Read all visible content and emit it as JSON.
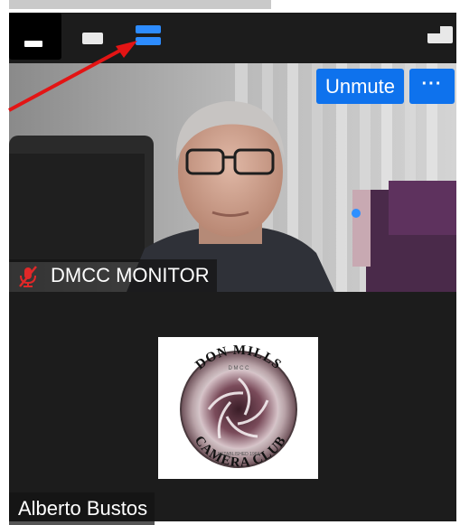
{
  "toolbar": {
    "views": [
      {
        "name": "minimize",
        "icon": "minimize-icon",
        "active": true
      },
      {
        "name": "speaker",
        "icon": "speaker-view-icon",
        "active": false
      },
      {
        "name": "gallery",
        "icon": "gallery-view-icon",
        "active": false,
        "color": "#2d8cff"
      }
    ],
    "exit_icon": "exit-minimized-icon"
  },
  "video_tile": {
    "unmute_label": "Unmute",
    "more_label": "···",
    "participant_name": "DMCC MONITOR",
    "mic_state": "muted",
    "mic_icon": "mic-muted-icon"
  },
  "second_tile": {
    "participant_name": "Alberto Bustos",
    "avatar_logo": {
      "top_text": "DON MILLS",
      "bottom_text": "CAMERA CLUB",
      "center_initials": "D M C C",
      "established": "ESTABLISHED 1963"
    }
  },
  "annotation": {
    "arrow_color": "#e31414",
    "points_to": "gallery-view-icon"
  },
  "colors": {
    "accent": "#0e72ed",
    "background": "#1c1c1c"
  }
}
